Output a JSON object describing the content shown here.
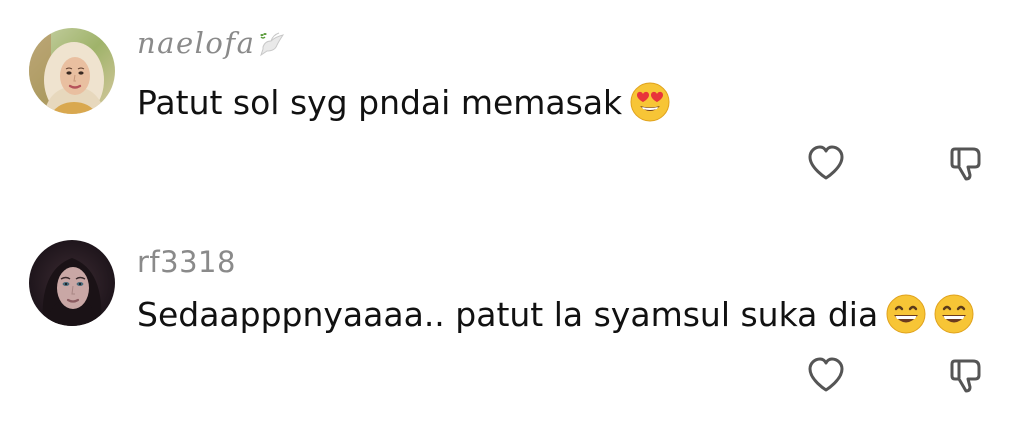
{
  "comments": [
    {
      "username": "naelofa",
      "text": "Patut sol syg pndai memasak",
      "emojis": [
        "heart-eyes-emoji"
      ],
      "username_decoration": "dove-icon",
      "actions": [
        "heart-icon",
        "thumbs-down-icon"
      ]
    },
    {
      "username": "rf3318",
      "text": "Sedaapppnyaaaa.. patut la syamsul suka dia",
      "emojis": [
        "grinning-emoji",
        "grinning-emoji"
      ],
      "actions": [
        "heart-icon",
        "thumbs-down-icon"
      ]
    }
  ],
  "colors": {
    "background": "#ffffff",
    "username": "#8a8a8a",
    "text": "#111111",
    "icon": "#555555"
  }
}
